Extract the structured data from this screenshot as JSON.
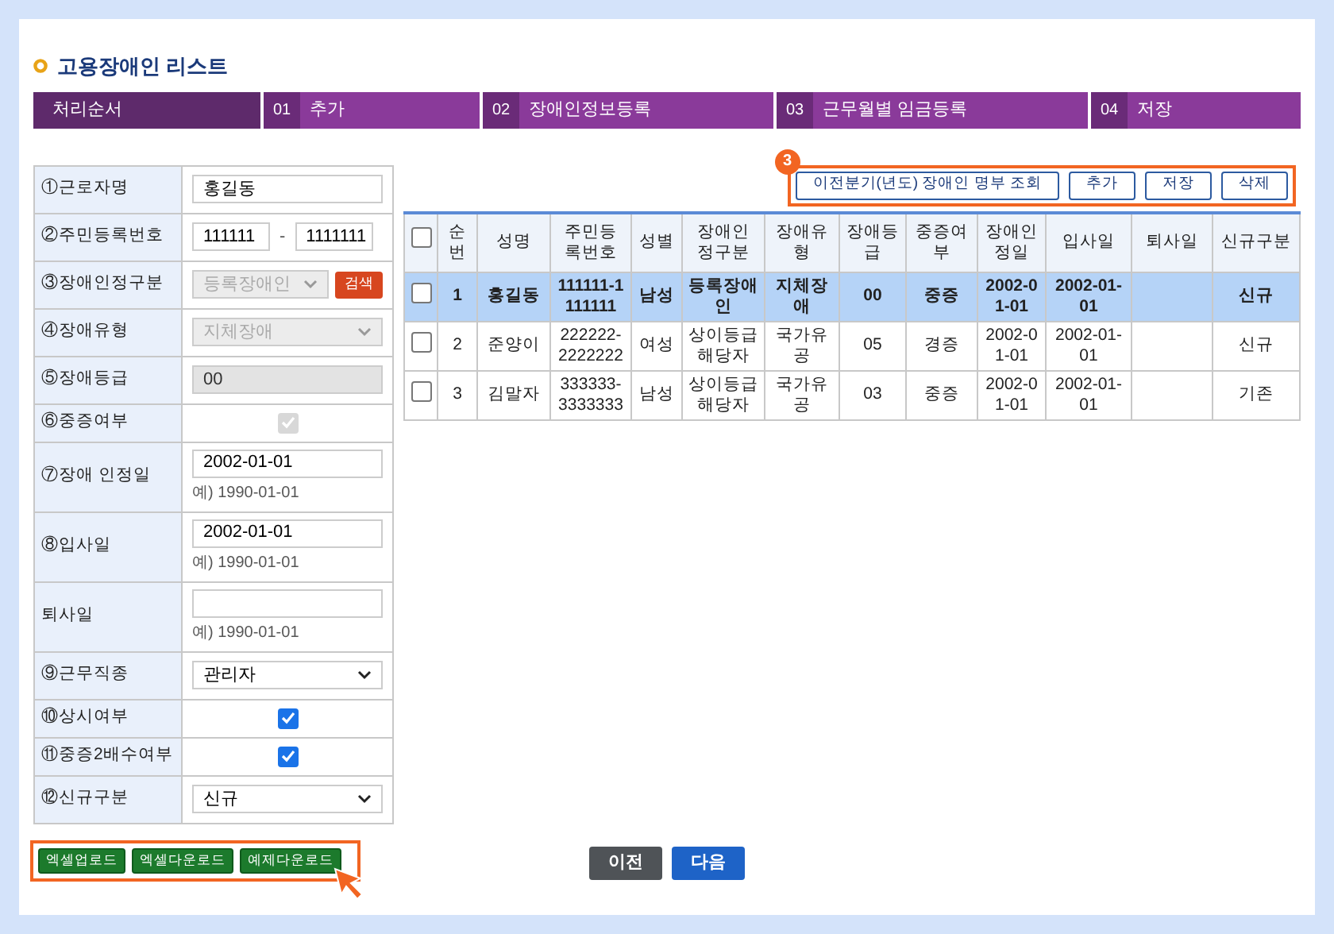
{
  "title": "고용장애인 리스트",
  "steps": [
    {
      "label": "처리순서",
      "selected": true
    },
    {
      "num": "01",
      "label": "추가",
      "selected": false
    },
    {
      "num": "02",
      "label": "장애인정보등록",
      "selected": false
    },
    {
      "num": "03",
      "label": "근무월별 임금등록",
      "selected": false
    },
    {
      "num": "04",
      "label": "저장",
      "selected": false
    }
  ],
  "form": [
    {
      "kind": "text",
      "label": "①근로자명",
      "value": "홍길동"
    },
    {
      "kind": "rrn",
      "label": "②주민등록번호",
      "value": "111111",
      "value2": "1111111",
      "separator": "-"
    },
    {
      "kind": "select-search",
      "label": "③장애인정구분",
      "value": "등록장애인",
      "disabled": true,
      "button": "검색"
    },
    {
      "kind": "select",
      "label": "④장애유형",
      "value": "지체장애",
      "disabled": true
    },
    {
      "kind": "readonly",
      "label": "⑤장애등급",
      "value": "00"
    },
    {
      "kind": "checkbox",
      "label": "⑥중증여부",
      "checked": true,
      "disabled": true
    },
    {
      "kind": "date",
      "label": "⑦장애 인정일",
      "value": "2002-01-01",
      "hint": "예) 1990-01-01"
    },
    {
      "kind": "date",
      "label": "⑧입사일",
      "value": "2002-01-01",
      "hint": "예) 1990-01-01"
    },
    {
      "kind": "date",
      "label": "퇴사일",
      "hint": "예) 1990-01-01"
    },
    {
      "kind": "select",
      "label": "⑨근무직종",
      "value": "관리자",
      "disabled": false
    },
    {
      "kind": "checkbox",
      "label": "⑩상시여부",
      "checked": true,
      "disabled": false
    },
    {
      "kind": "checkbox",
      "label": "⑪중증2배수여부",
      "checked": true,
      "disabled": false
    },
    {
      "kind": "select",
      "label": "⑫신규구분",
      "value": "신규",
      "disabled": false
    }
  ],
  "excel_buttons": [
    "엑셀업로드",
    "엑셀다운로드",
    "예제다운로드"
  ],
  "annotation_badge": "3",
  "toolbar_buttons": [
    "이전분기(년도) 장애인 명부 조회",
    "추가",
    "저장",
    "삭제"
  ],
  "table": {
    "header_checked": false,
    "columns": [
      "순번",
      "성명",
      "주민등록번호",
      "성별",
      "장애인정구분",
      "장애유형",
      "장애등급",
      "중증여부",
      "장애인정일",
      "입사일",
      "퇴사일",
      "신규구분"
    ],
    "rows": [
      {
        "selected": true,
        "checked": false,
        "cells": [
          "1",
          "홍길동",
          "111111-1111111",
          "남성",
          "등록장애인",
          "지체장애",
          "00",
          "중증",
          "2002-01-01",
          "2002-01-01",
          "",
          "신규"
        ]
      },
      {
        "selected": false,
        "checked": false,
        "cells": [
          "2",
          "준양이",
          "222222-2222222",
          "여성",
          "상이등급해당자",
          "국가유공",
          "05",
          "경증",
          "2002-01-01",
          "2002-01-01",
          "",
          "신규"
        ]
      },
      {
        "selected": false,
        "checked": false,
        "cells": [
          "3",
          "김말자",
          "333333-3333333",
          "남성",
          "상이등급해당자",
          "국가유공",
          "03",
          "중증",
          "2002-01-01",
          "2002-01-01",
          "",
          "기존"
        ]
      }
    ]
  },
  "nav_buttons": [
    {
      "kind": "prev",
      "label": "이전"
    },
    {
      "kind": "next",
      "label": "다음"
    }
  ]
}
